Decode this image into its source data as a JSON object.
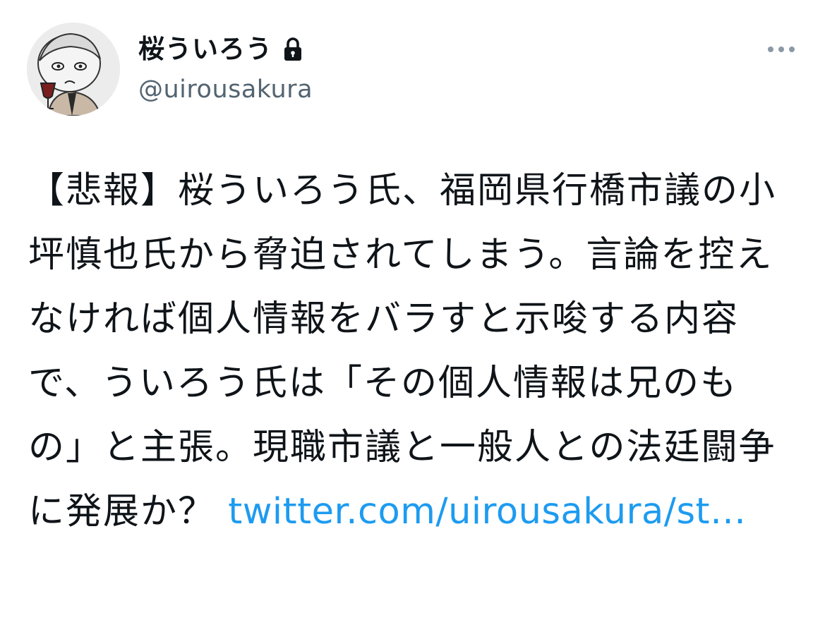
{
  "user": {
    "display_name": "桜ういろう",
    "handle": "@uirousakura",
    "protected": true
  },
  "tweet": {
    "text": "【悲報】桜ういろう氏、福岡県行橋市議の小坪慎也氏から脅迫されてしまう。言論を控えなければ個人情報をバラすと示唆する内容で、ういろう氏は「その個人情報は兄のもの」と主張。現職市議と一般人との法廷闘争に発展か？ ",
    "link_text": "twitter.com/uirousakura/st…"
  },
  "icons": {
    "lock": "lock-icon",
    "more": "more-icon",
    "avatar": "avatar"
  },
  "colors": {
    "text": "#0f1419",
    "secondary": "#536471",
    "link": "#1d9bf0"
  }
}
